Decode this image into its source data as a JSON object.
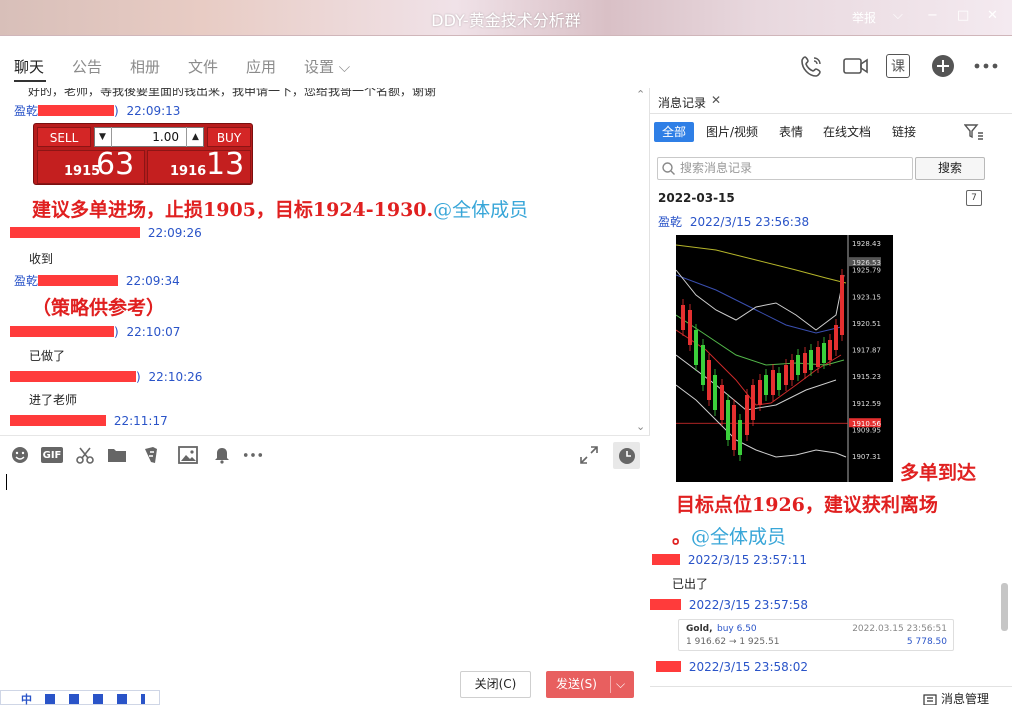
{
  "window": {
    "title": "DDY-黄金技术分析群",
    "report_label": "举报",
    "controls": {
      "dropdown": "⌵",
      "minimize": "−",
      "maximize": "□",
      "close": "✕"
    }
  },
  "tabs": [
    {
      "label": "聊天",
      "active": true
    },
    {
      "label": "公告"
    },
    {
      "label": "相册"
    },
    {
      "label": "文件"
    },
    {
      "label": "应用"
    },
    {
      "label": "设置 ⌵"
    }
  ],
  "top_actions": {
    "course_label": "课"
  },
  "chat": {
    "cut_off_line": "好的，老师，等我後要里面的钱出来，我申请一下，您给我哥一个名额，谢谢",
    "messages": [
      {
        "sender": "盈乾",
        "time": "22:09:13"
      },
      {
        "sender": "",
        "time": "22:09:26",
        "text": "收到"
      },
      {
        "sender": "盈乾",
        "time": "22:09:34"
      },
      {
        "sender": "",
        "time": "22:10:07",
        "text": "已做了"
      },
      {
        "sender": "",
        "time": "22:10:26",
        "text": "进了老师"
      },
      {
        "sender": "",
        "time": "22:11:17"
      }
    ],
    "trade_widget": {
      "sell_label": "SELL",
      "buy_label": "BUY",
      "quantity": "1.00",
      "sell_price_small": "1915",
      "sell_price_big": "63",
      "buy_price_small": "1916",
      "buy_price_big": "13"
    },
    "callout_main": "建议多单进场，止损1905，目标1924-1930.",
    "callout_mention": "@全体成员",
    "callout_strategy": "（策略供参考）"
  },
  "composer": {
    "close_label": "关闭(C)",
    "send_label": "发送(S)",
    "send_arrow": "⌵",
    "gif_label": "GIF"
  },
  "ime": {
    "label": "中"
  },
  "history": {
    "tab_label": "消息记录",
    "filters": [
      "全部",
      "图片/视频",
      "表情",
      "在线文档",
      "链接"
    ],
    "search_placeholder": "搜索消息记录",
    "search_button": "搜索",
    "date": "2022-03-15",
    "calendar_day": "7",
    "entries": [
      {
        "sender": "盈乾",
        "time": "2022/3/15 23:56:38"
      },
      {
        "sender": "",
        "time": "2022/3/15 23:57:11",
        "text": "已出了"
      },
      {
        "sender": "",
        "time": "2022/3/15 23:57:58"
      },
      {
        "sender": "",
        "time": "2022/3/15 23:58:02"
      }
    ],
    "callout_line1": "多单到达",
    "callout_line2": "目标点位1926，建议获利离场",
    "callout_line3": "。",
    "callout_mention": "@全体成员",
    "gold_card": {
      "symbol": "Gold,",
      "side": "buy 6.50",
      "prices": "1 916.62 → 1 925.51",
      "datetime": "2022.03.15 23:56:51",
      "profit": "5 778.50"
    },
    "chart_prices": [
      "1928.43",
      "1926.53",
      "1925.79",
      "1923.15",
      "1920.51",
      "1917.87",
      "1915.23",
      "1912.59",
      "1910.56",
      "1909.95",
      "1907.31"
    ],
    "manage_label": "消息管理"
  },
  "colors": {
    "accent_blue": "#2f7fe6",
    "link_blue": "#2a54c8",
    "callout_red": "#e02020",
    "mention_blue": "#38a6d8",
    "send_red": "#e85f5f"
  }
}
